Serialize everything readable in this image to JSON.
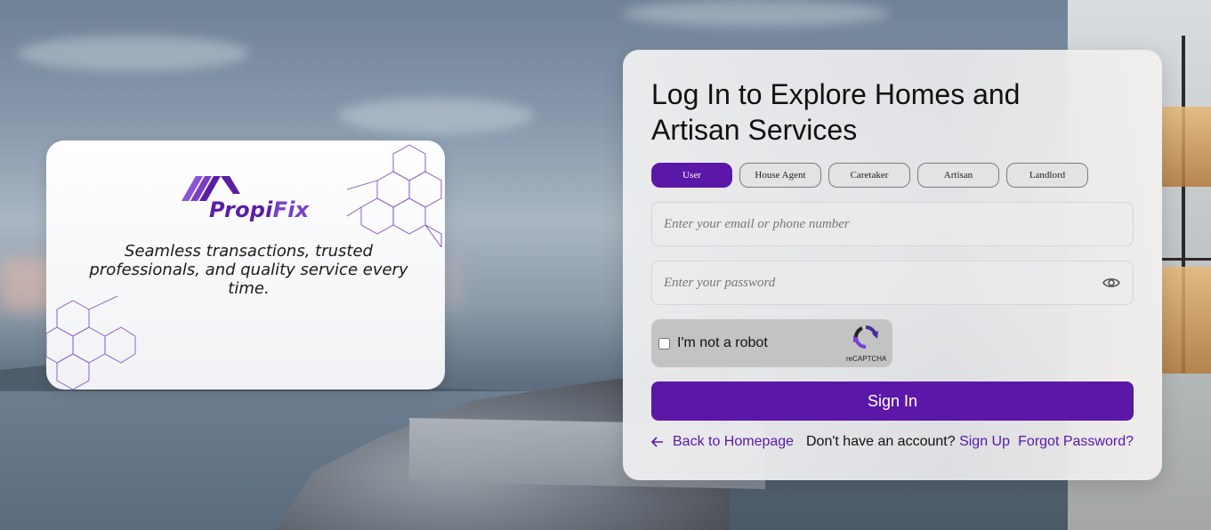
{
  "brand": {
    "name_part1": "Propi",
    "name_part2": "Fix",
    "tagline": "Seamless transactions, trusted professionals, and quality service every time."
  },
  "login": {
    "title": "Log In to Explore Homes and Artisan Services",
    "roles": [
      "User",
      "House Agent",
      "Caretaker",
      "Artisan",
      "Landlord"
    ],
    "active_role": "User",
    "email_placeholder": "Enter your email or phone number",
    "password_placeholder": "Enter your password",
    "captcha_label": "I'm not a robot",
    "captcha_brand": "reCAPTCHA",
    "signin_label": "Sign In",
    "back_label": "Back to Homepage",
    "no_account_text": "Don't have an account?",
    "signup_label": "Sign Up",
    "forgot_label": "Forgot Password?"
  },
  "colors": {
    "accent": "#5a17a8",
    "link": "#5a17a8"
  },
  "icons": {
    "back": "arrow-left-icon",
    "password_toggle": "eye-icon",
    "captcha": "recaptcha-icon",
    "logo": "roof-logo-icon"
  }
}
